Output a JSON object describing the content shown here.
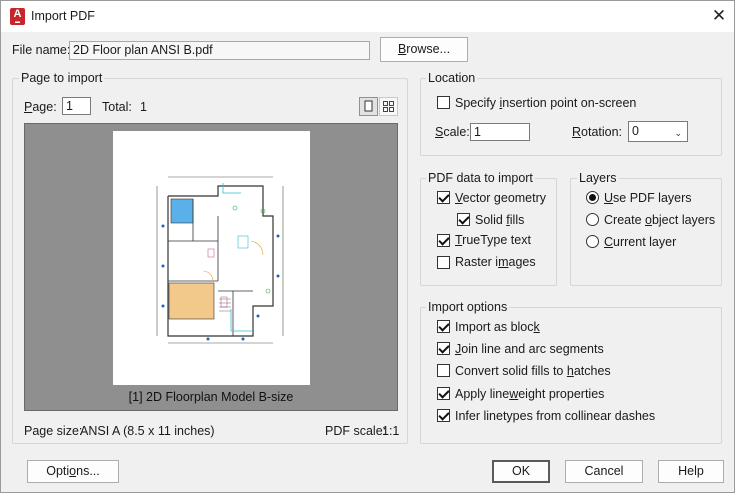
{
  "window": {
    "title": "Import PDF",
    "app_icon_letter": "A"
  },
  "file": {
    "label": "File name:",
    "value": "2D Floor plan ANSI B.pdf",
    "browse_label": "Browse..."
  },
  "page_to_import": {
    "legend": "Page to import",
    "page_label": "Page:",
    "page_value": "1",
    "total_label": "Total:",
    "total_value": "1",
    "preview_caption": "[1] 2D Floorplan Model B-size",
    "page_size_label": "Page size:",
    "page_size_value": "ANSI A (8.5 x 11 inches)",
    "pdf_scale_label": "PDF scale:",
    "pdf_scale_value": "1:1"
  },
  "location": {
    "legend": "Location",
    "specify_label": "Specify insertion point on-screen",
    "specify_checked": false,
    "scale_label": "Scale:",
    "scale_value": "1",
    "rotation_label": "Rotation:",
    "rotation_value": "0"
  },
  "pdf_data": {
    "legend": "PDF data to import",
    "items": [
      {
        "label": "Vector geometry",
        "checked": true
      },
      {
        "label": "Solid fills",
        "checked": true
      },
      {
        "label": "TrueType text",
        "checked": true
      },
      {
        "label": "Raster images",
        "checked": false
      }
    ]
  },
  "layers": {
    "legend": "Layers",
    "options": [
      {
        "label": "Use PDF layers",
        "selected": true
      },
      {
        "label": "Create object layers",
        "selected": false
      },
      {
        "label": "Current layer",
        "selected": false
      }
    ]
  },
  "import_options": {
    "legend": "Import options",
    "items": [
      {
        "label": "Import as block",
        "checked": true
      },
      {
        "label": "Join line and arc segments",
        "checked": true
      },
      {
        "label": "Convert solid fills to hatches",
        "checked": false
      },
      {
        "label": "Apply lineweight properties",
        "checked": true
      },
      {
        "label": "Infer linetypes from collinear dashes",
        "checked": true
      }
    ]
  },
  "buttons": {
    "options": "Options...",
    "ok": "OK",
    "cancel": "Cancel",
    "help": "Help"
  },
  "colors": {
    "accent_red": "#c8262a",
    "preview_bg": "#8f8f8f",
    "dialog_bg": "#f0f0f0"
  }
}
